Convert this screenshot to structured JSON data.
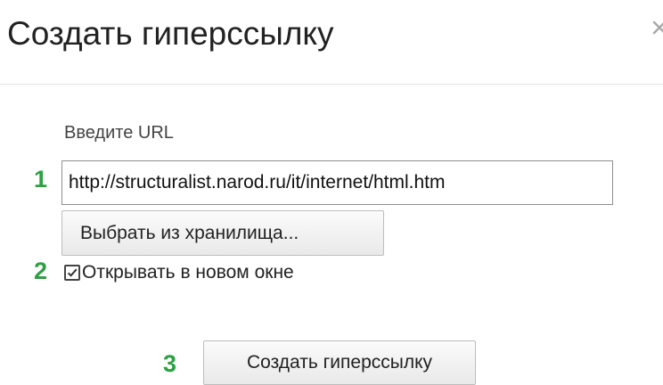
{
  "dialog": {
    "title": "Создать гиперссылку",
    "close_icon": "close-icon"
  },
  "form": {
    "url_label": "Введите URL",
    "url_value": "http://structuralist.narod.ru/it/internet/html.htm",
    "browse_button_label": "Выбрать из хранилища...",
    "open_new_window_label": "Открывать в новом окне",
    "open_new_window_checked": true,
    "create_button_label": "Создать гиперссылку"
  },
  "annotations": {
    "step_1": "1",
    "step_2": "2",
    "step_3": "3",
    "color": "#2ea043"
  }
}
